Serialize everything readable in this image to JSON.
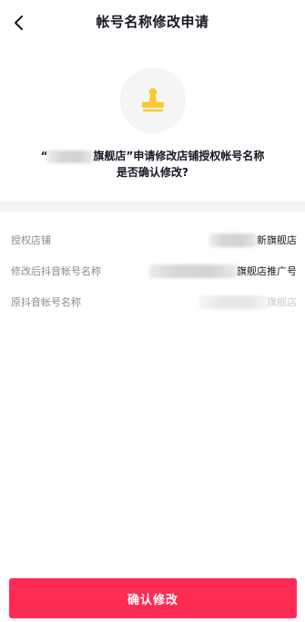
{
  "nav": {
    "title": "帐号名称修改申请",
    "back_icon": "chevron-left-icon"
  },
  "stamp": {
    "icon": "stamp-icon",
    "circle_color": "#f5f5f6",
    "icon_color": "#fdc82f"
  },
  "prompt": {
    "line1_open_quote": "“",
    "line1_store_suffix": "旗舰店",
    "line1_rest": "”申请修改店铺授权帐号名称",
    "line2": "是否确认修改?"
  },
  "details": {
    "store": {
      "label": "授权店铺",
      "value_visible": "新旗舰店"
    },
    "new_name": {
      "label": "修改后抖音帐号名称",
      "value_visible": "旗舰店推广号"
    },
    "old_name": {
      "label": "原抖音帐号名称",
      "value_visible": "旗舰店"
    }
  },
  "confirm_button": {
    "label": "确认修改",
    "color": "#fe2c55"
  }
}
